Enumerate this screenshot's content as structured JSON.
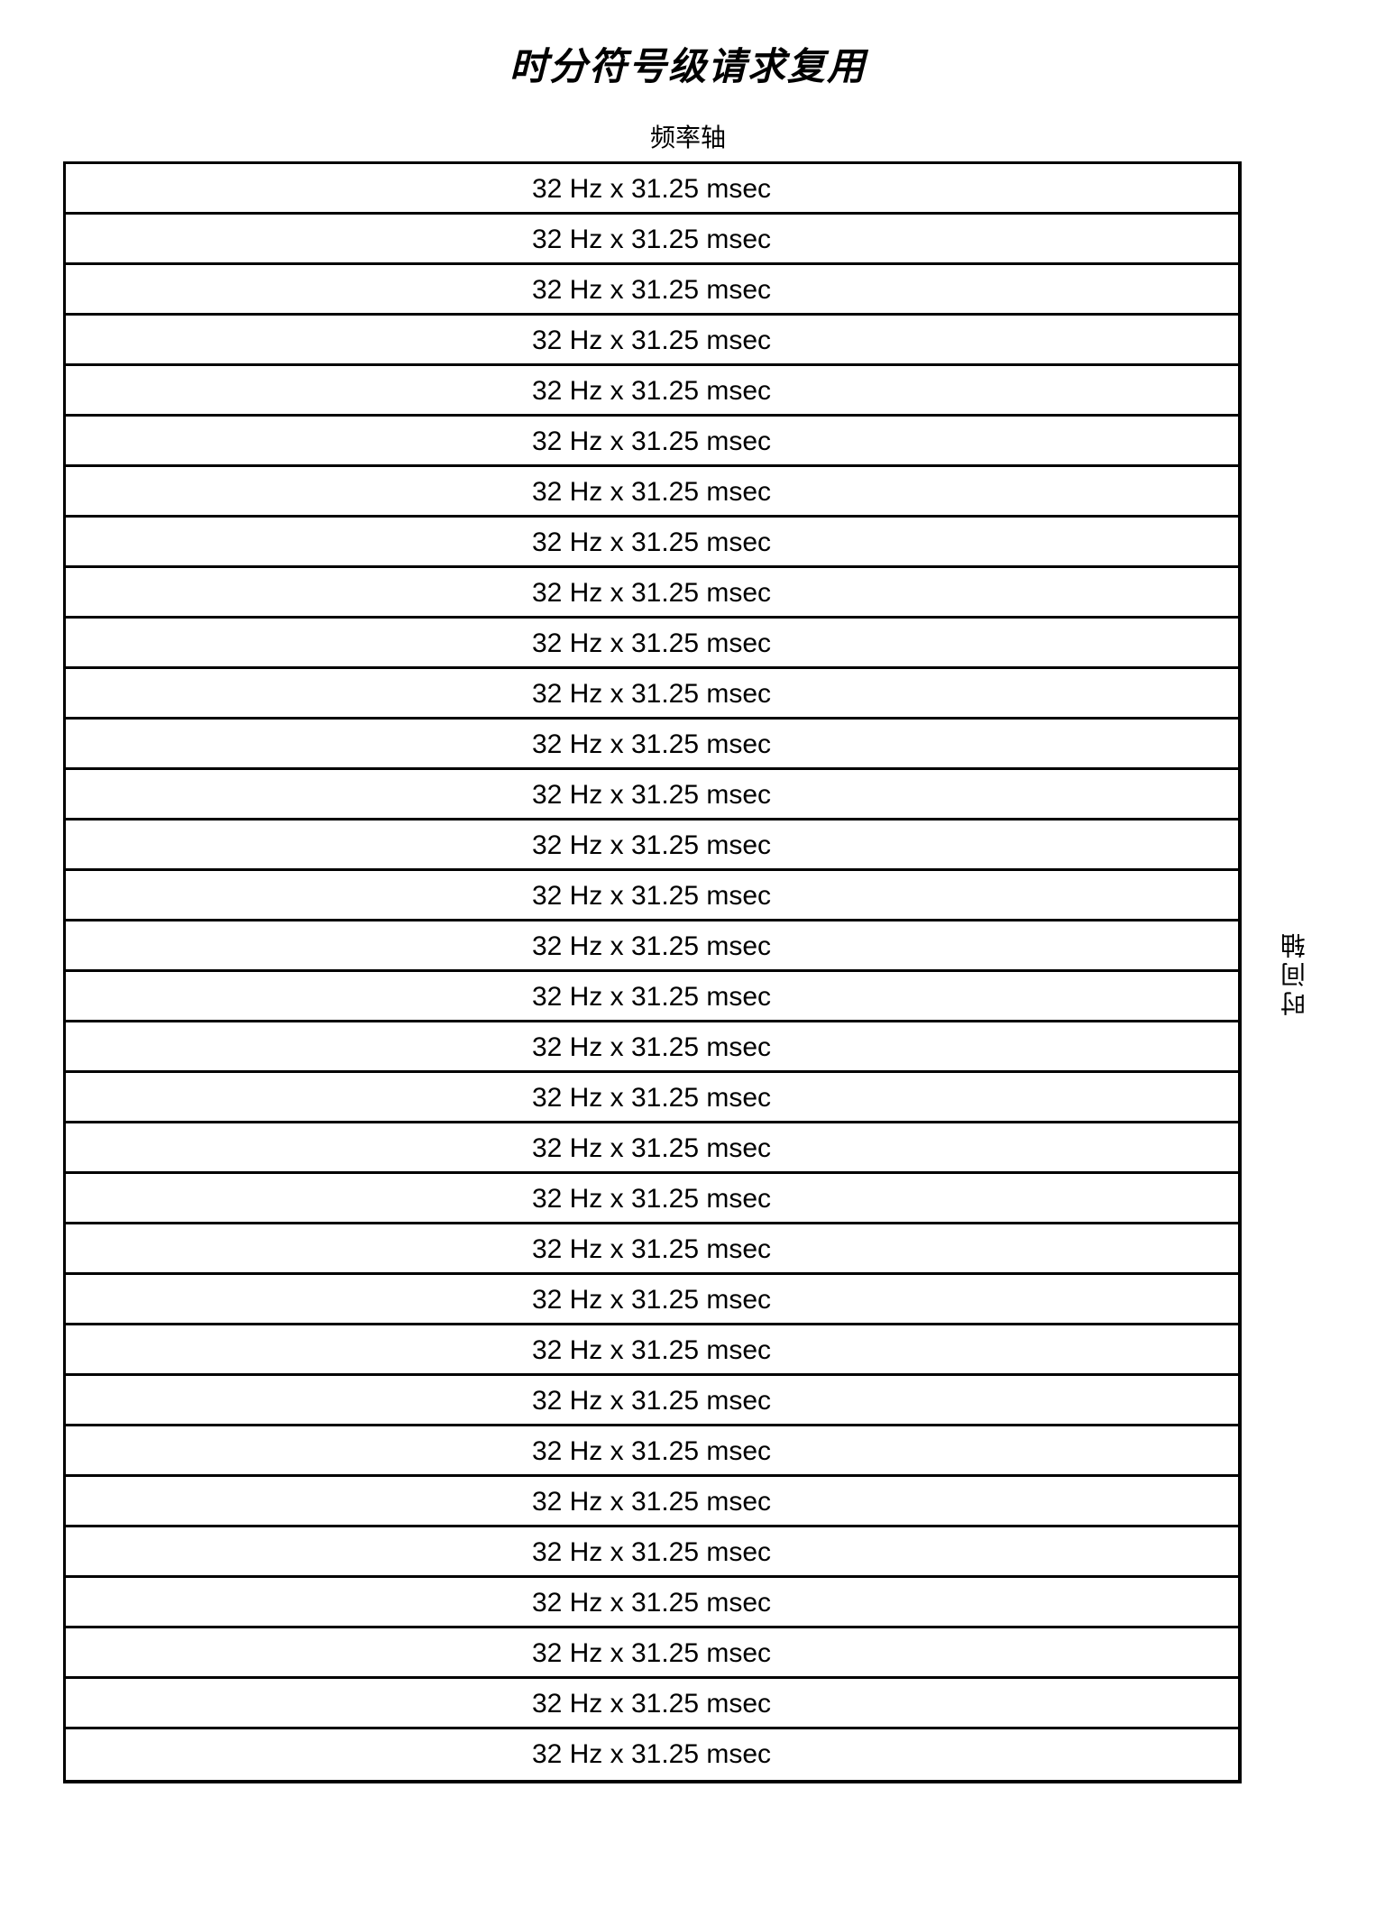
{
  "title": "时分符号级请求复用",
  "freq_axis_label": "频率轴",
  "time_axis_label": "时间轴",
  "cell_value": "32 Hz x 31.25 msec",
  "chart_data": {
    "type": "table",
    "title": "时分符号级请求复用",
    "columns": [
      "频率轴"
    ],
    "row_axis": "时间轴",
    "rows": [
      "32 Hz x 31.25 msec",
      "32 Hz x 31.25 msec",
      "32 Hz x 31.25 msec",
      "32 Hz x 31.25 msec",
      "32 Hz x 31.25 msec",
      "32 Hz x 31.25 msec",
      "32 Hz x 31.25 msec",
      "32 Hz x 31.25 msec",
      "32 Hz x 31.25 msec",
      "32 Hz x 31.25 msec",
      "32 Hz x 31.25 msec",
      "32 Hz x 31.25 msec",
      "32 Hz x 31.25 msec",
      "32 Hz x 31.25 msec",
      "32 Hz x 31.25 msec",
      "32 Hz x 31.25 msec",
      "32 Hz x 31.25 msec",
      "32 Hz x 31.25 msec",
      "32 Hz x 31.25 msec",
      "32 Hz x 31.25 msec",
      "32 Hz x 31.25 msec",
      "32 Hz x 31.25 msec",
      "32 Hz x 31.25 msec",
      "32 Hz x 31.25 msec",
      "32 Hz x 31.25 msec",
      "32 Hz x 31.25 msec",
      "32 Hz x 31.25 msec",
      "32 Hz x 31.25 msec",
      "32 Hz x 31.25 msec",
      "32 Hz x 31.25 msec",
      "32 Hz x 31.25 msec",
      "32 Hz x 31.25 msec"
    ]
  }
}
